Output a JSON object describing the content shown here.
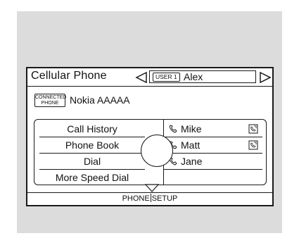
{
  "header": {
    "title": "Cellular Phone",
    "user_badge": "USER 1",
    "user_name": "Alex"
  },
  "connection": {
    "badge_line1": "CONNECTED",
    "badge_line2": "PHONE",
    "phone_name": "Nokia AAAAA"
  },
  "menu": {
    "items": [
      {
        "label": "Call History"
      },
      {
        "label": "Phone Book"
      },
      {
        "label": "Dial"
      },
      {
        "label": "More Speed Dial"
      }
    ]
  },
  "speed_dial": {
    "contacts": [
      {
        "name": "Mike",
        "has_voice_tag": true
      },
      {
        "name": "Matt",
        "has_voice_tag": true
      },
      {
        "name": "Jane",
        "has_voice_tag": false
      }
    ]
  },
  "footer": {
    "left": "PHONE",
    "right": "SETUP"
  }
}
